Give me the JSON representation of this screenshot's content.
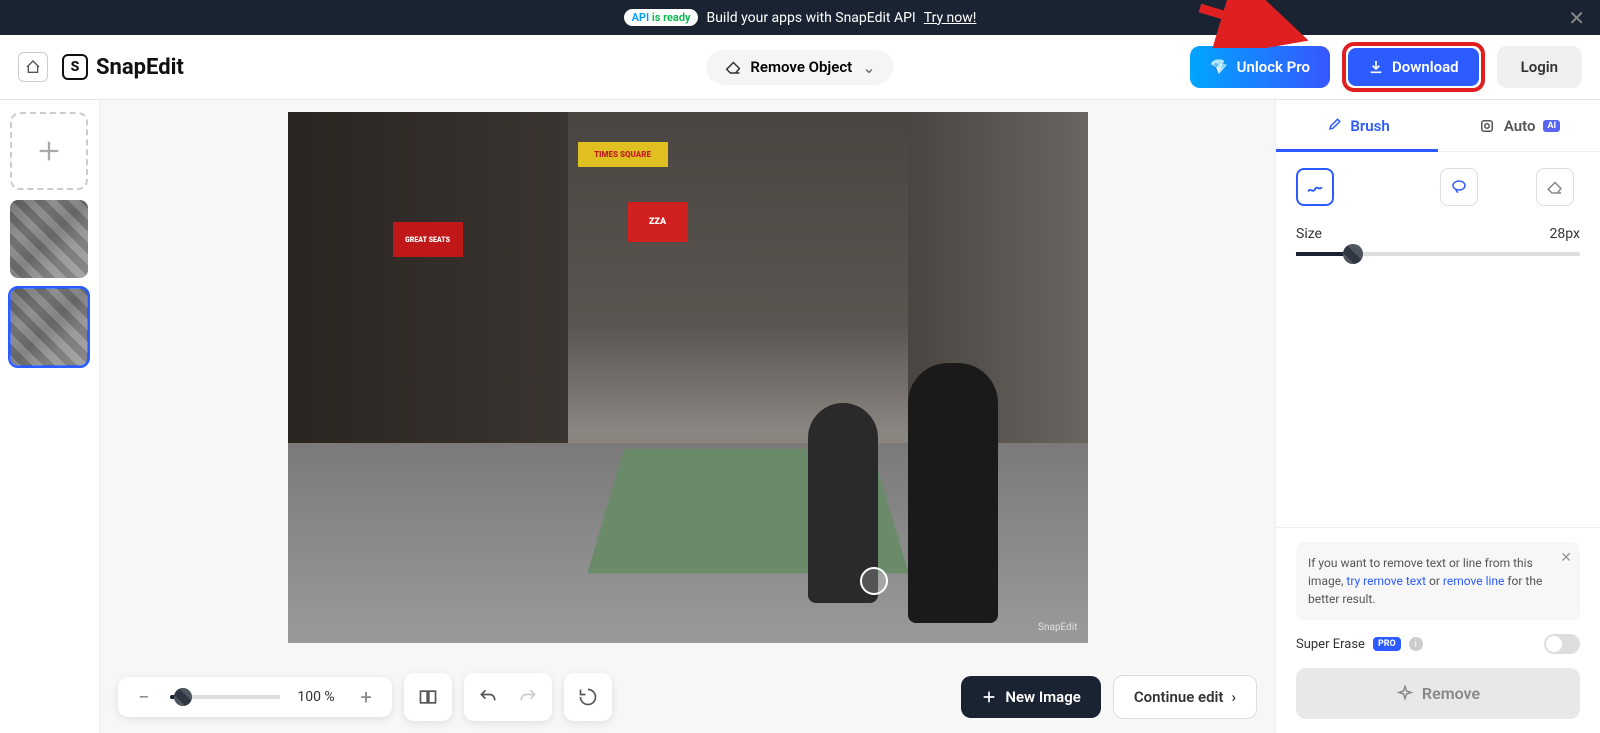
{
  "banner": {
    "badge_api": "API",
    "badge_ready": "is ready",
    "text": "Build your apps with SnapEdit API",
    "try": "Try now!"
  },
  "logo": "SnapEdit",
  "center_tool": "Remove Object",
  "header": {
    "unlock": "Unlock Pro",
    "download": "Download",
    "login": "Login"
  },
  "zoom": {
    "value": "100 %"
  },
  "bottom": {
    "new_image": "New Image",
    "continue": "Continue edit"
  },
  "panel": {
    "tab_brush": "Brush",
    "tab_auto": "Auto",
    "ai_badge": "AI",
    "size_label": "Size",
    "size_value": "28px",
    "tip_before": "If you want to remove text or line from this image, ",
    "tip_link1": "try remove text",
    "tip_or": " or ",
    "tip_link2": "remove line",
    "tip_after": " for the better result.",
    "super_erase": "Super Erase",
    "pro": "PRO",
    "remove": "Remove"
  },
  "signs": {
    "pizza": "ZZA",
    "times": "TIMES SQUARE",
    "seats": "GREAT SEATS"
  },
  "watermark": "SnapEdit"
}
